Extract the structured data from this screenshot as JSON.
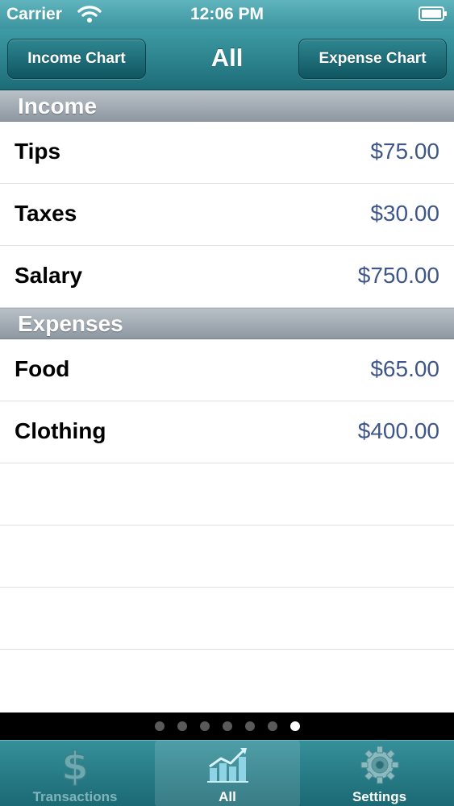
{
  "status_bar": {
    "carrier": "Carrier",
    "time": "12:06 PM",
    "wifi_icon": "wifi-icon",
    "battery_icon": "battery-icon"
  },
  "nav_bar": {
    "title": "All",
    "left_button": "Income Chart",
    "right_button": "Expense Chart"
  },
  "sections": [
    {
      "title": "Income",
      "rows": [
        {
          "label": "Tips",
          "value": "$75.00"
        },
        {
          "label": "Taxes",
          "value": "$30.00"
        },
        {
          "label": "Salary",
          "value": "$750.00"
        }
      ]
    },
    {
      "title": "Expenses",
      "rows": [
        {
          "label": "Food",
          "value": "$65.00"
        },
        {
          "label": "Clothing",
          "value": "$400.00"
        }
      ]
    }
  ],
  "page_indicator": {
    "count": 7,
    "active_index": 6
  },
  "tab_bar": {
    "tabs": [
      {
        "label": "Transactions",
        "icon": "dollar-icon",
        "state": "dimmed"
      },
      {
        "label": "All",
        "icon": "chart-icon",
        "state": "selected"
      },
      {
        "label": "Settings",
        "icon": "gear-icon",
        "state": "normal"
      }
    ]
  },
  "colors": {
    "bar_teal": "#2a7f89",
    "value_blue": "#3f5688",
    "section_gray": "#9aa3ac"
  }
}
